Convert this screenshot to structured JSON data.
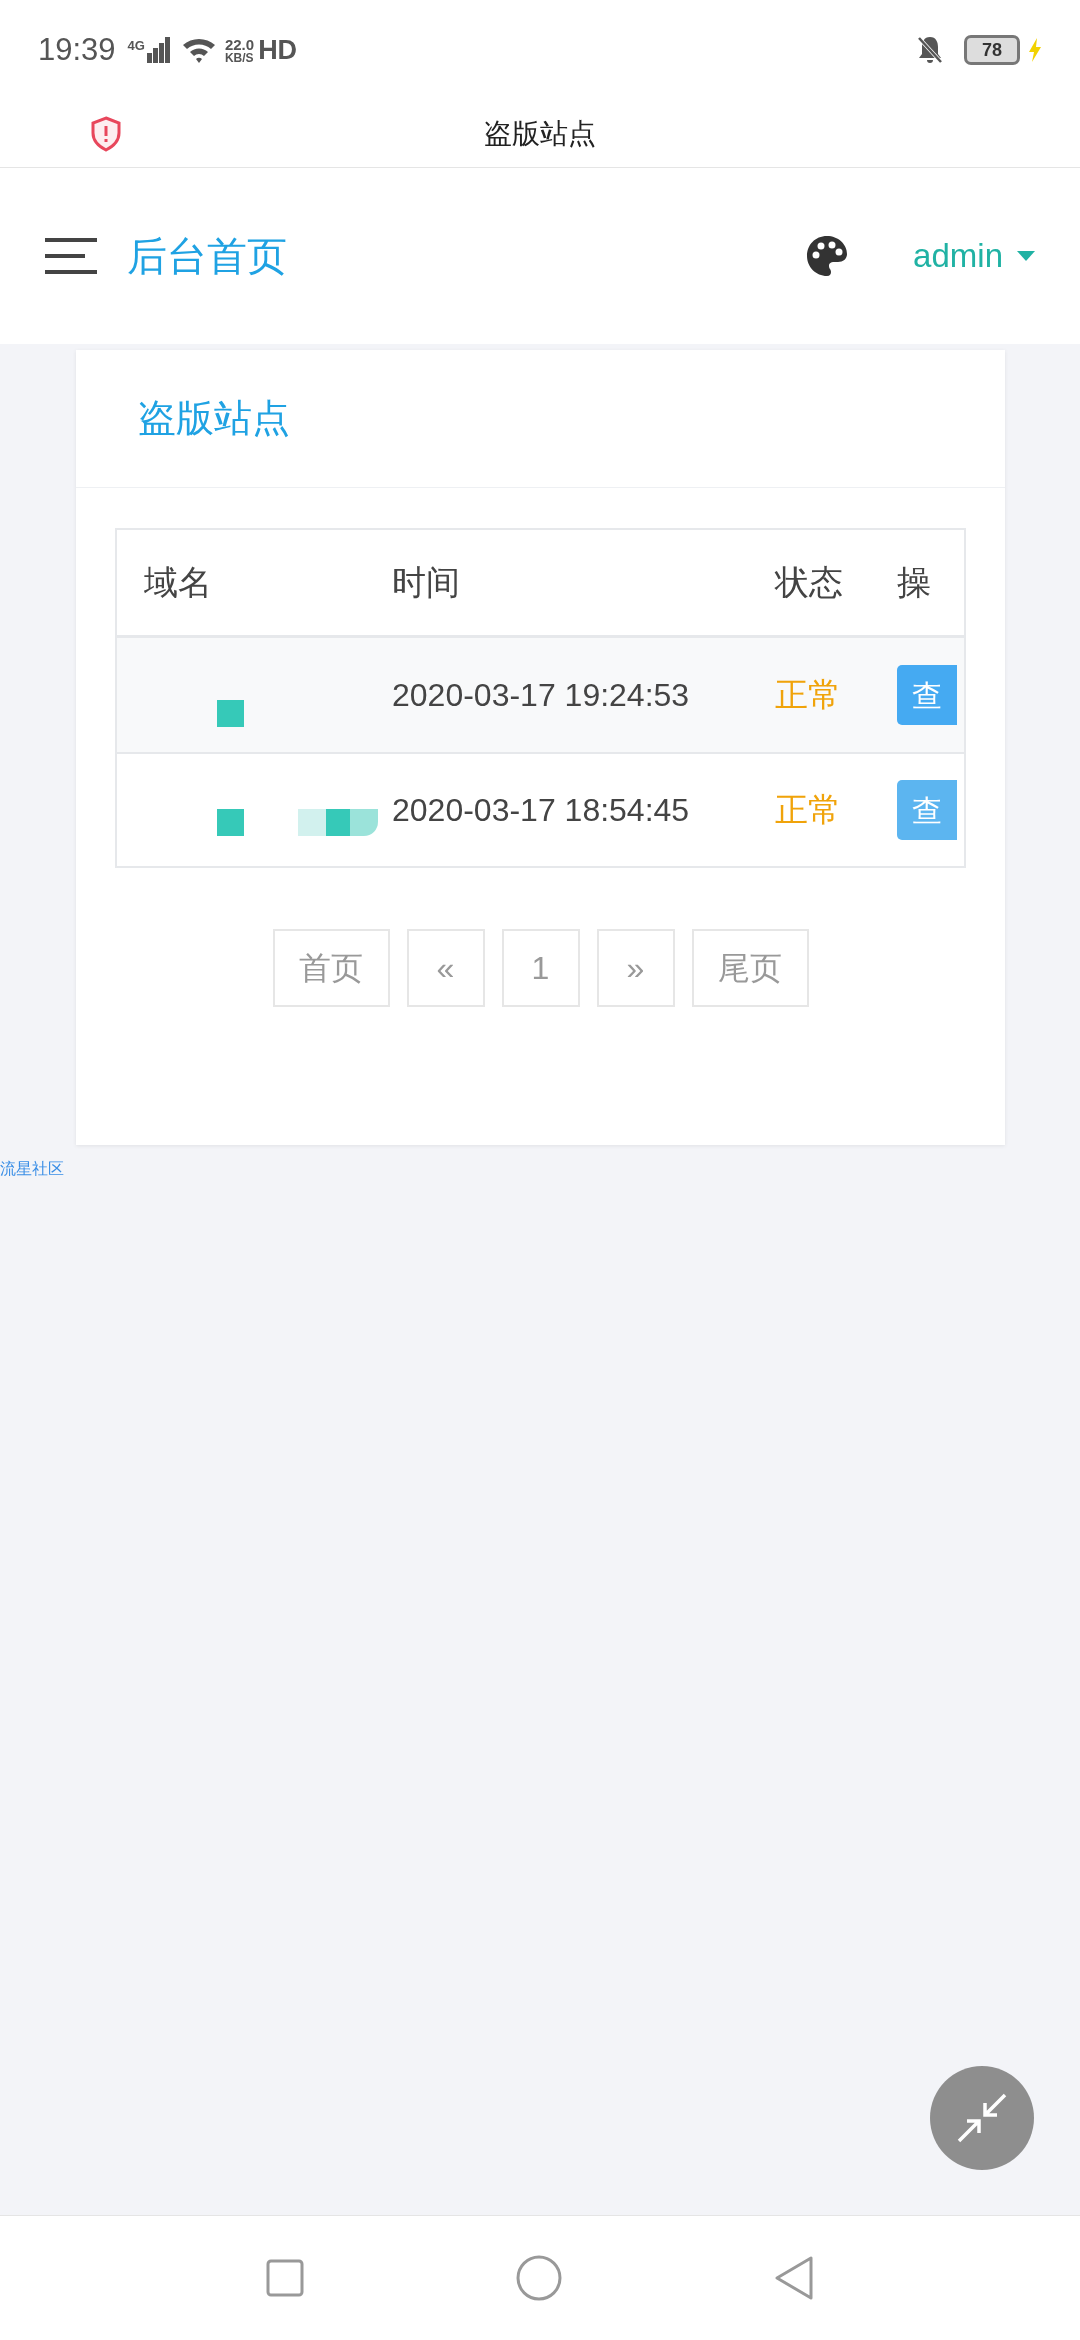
{
  "status_bar": {
    "time": "19:39",
    "network": "4G",
    "speed_value": "22.0",
    "speed_unit": "KB/S",
    "hd": "HD",
    "battery": "78"
  },
  "browser": {
    "title": "盗版站点"
  },
  "header": {
    "title": "后台首页",
    "user": "admin"
  },
  "card": {
    "title": "盗版站点"
  },
  "table": {
    "columns": [
      "域名",
      "时间",
      "状态",
      "操"
    ],
    "rows": [
      {
        "time": "2020-03-17 19:24:53",
        "status": "正常",
        "action": "查",
        "striped": true
      },
      {
        "time": "2020-03-17 18:54:45",
        "status": "正常",
        "action": "查",
        "striped": false
      }
    ]
  },
  "pagination": [
    "首页",
    "«",
    "1",
    "»",
    "尾页"
  ],
  "footer_link": "流星社区"
}
